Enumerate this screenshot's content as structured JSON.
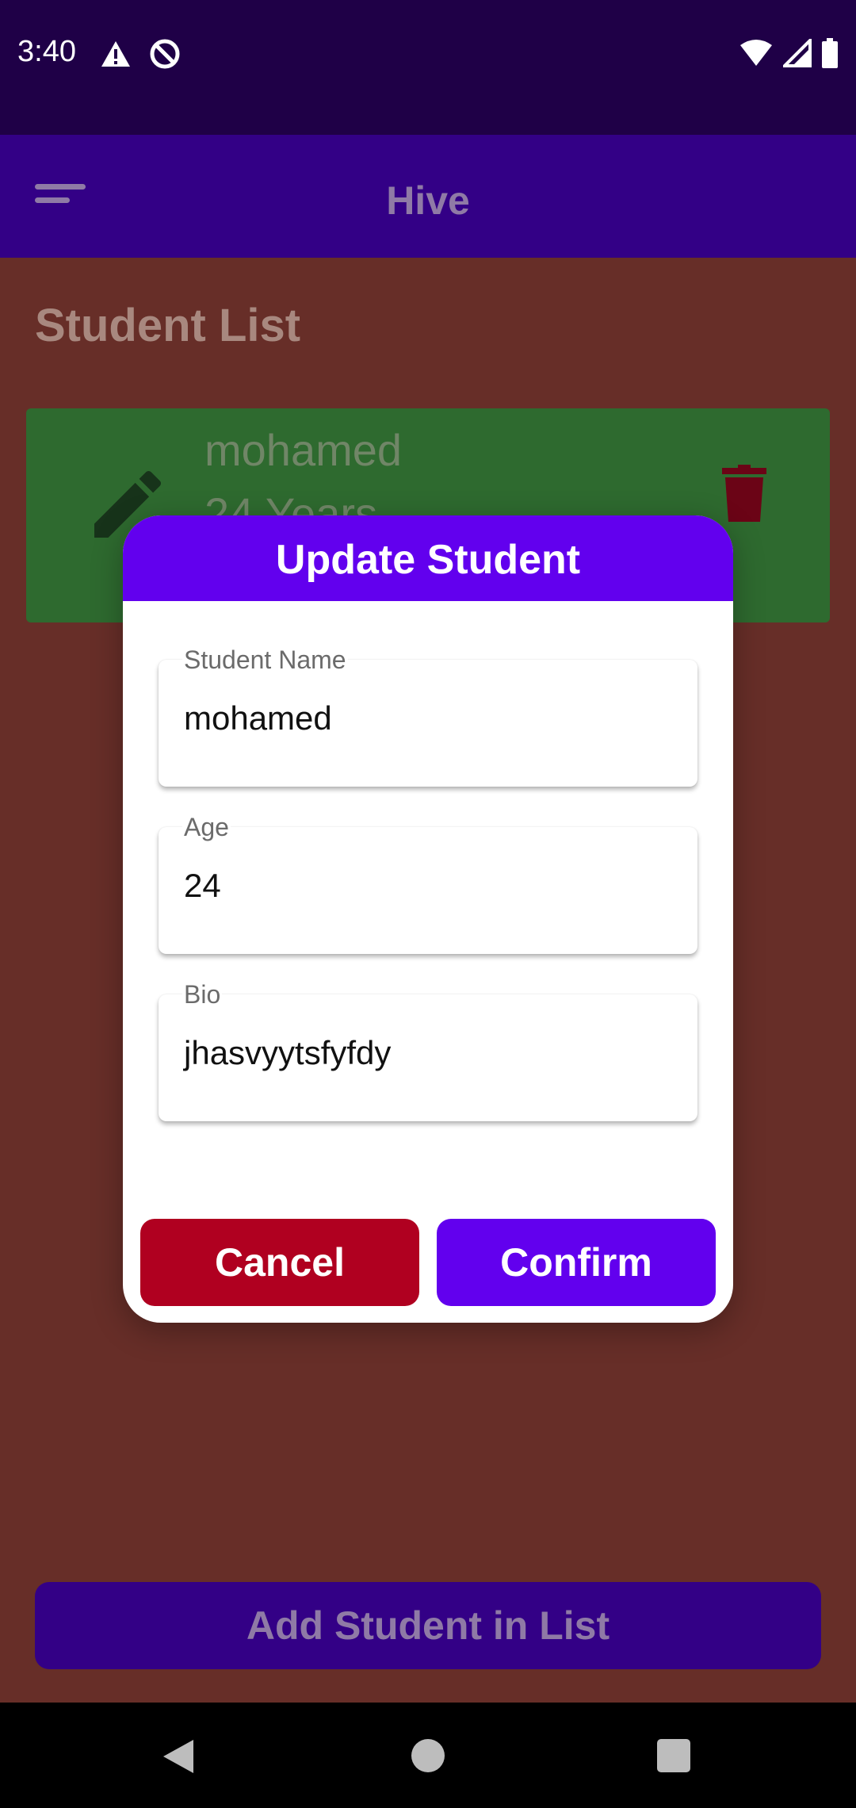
{
  "status_bar": {
    "time": "3:40",
    "icons": [
      "warning-icon",
      "do-not-disturb-icon",
      "wifi-icon",
      "signal-icon",
      "battery-icon"
    ]
  },
  "app_bar": {
    "title": "Hive",
    "menu_icon": "menu-icon"
  },
  "page": {
    "section_title": "Student List"
  },
  "student_card": {
    "name": "mohamed",
    "age_text": "24 Years",
    "edit_icon": "pencil-icon",
    "delete_icon": "trash-icon"
  },
  "dialog": {
    "title": "Update Student",
    "fields": [
      {
        "label": "Student Name",
        "value": "mohamed"
      },
      {
        "label": "Age",
        "value": "24"
      },
      {
        "label": "Bio",
        "value": "jhasvyytsfyfdy"
      }
    ],
    "cancel_label": "Cancel",
    "confirm_label": "Confirm"
  },
  "add_button_label": "Add Student in List",
  "colors": {
    "primary": "#6200ee",
    "cancel": "#b00020",
    "card": "#388e3c",
    "background": "#8b3a2f",
    "app_bar": "#3700b3"
  },
  "nav_bar": {
    "icons": [
      "back-icon",
      "home-icon",
      "recents-icon"
    ]
  }
}
